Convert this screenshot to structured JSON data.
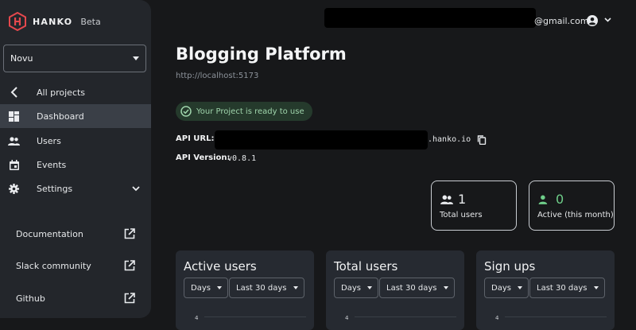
{
  "brand": {
    "name": "HANKO",
    "tag": "Beta",
    "accent": "#e5484d"
  },
  "sidebar": {
    "project_selector": {
      "value": "Novu"
    },
    "items": [
      {
        "label": "All projects",
        "icon": "chevron-left-icon"
      },
      {
        "label": "Dashboard",
        "icon": "dashboard-icon",
        "active": true
      },
      {
        "label": "Users",
        "icon": "users-icon"
      },
      {
        "label": "Events",
        "icon": "calendar-icon"
      },
      {
        "label": "Settings",
        "icon": "gear-icon",
        "expandable": true
      }
    ],
    "links": [
      {
        "label": "Documentation",
        "icon": "external-link-icon"
      },
      {
        "label": "Slack community",
        "icon": "external-link-icon"
      },
      {
        "label": "Github",
        "icon": "external-link-icon"
      }
    ]
  },
  "topbar": {
    "email_suffix": "@gmail.com"
  },
  "project": {
    "title": "Blogging Platform",
    "url": "http://localhost:5173",
    "status": "Your Project is ready to use",
    "status_color": "#9fd4ab",
    "api_url_label": "API URL:",
    "api_url_suffix": ".hanko.io",
    "api_version_label": "API Version:",
    "api_version": "v0.8.1"
  },
  "stats": [
    {
      "value": "1",
      "label": "Total users",
      "icon": "users-icon"
    },
    {
      "value": "0",
      "label": "Active (this month)",
      "icon": "person-icon",
      "color": "#6fcf8a"
    }
  ],
  "panels": [
    {
      "title": "Active users",
      "interval": "Days",
      "range": "Last 30 days",
      "ytick": "4"
    },
    {
      "title": "Total users",
      "interval": "Days",
      "range": "Last 30 days",
      "ytick": "4"
    },
    {
      "title": "Sign ups",
      "interval": "Days",
      "range": "Last 30 days",
      "ytick": "4"
    }
  ]
}
